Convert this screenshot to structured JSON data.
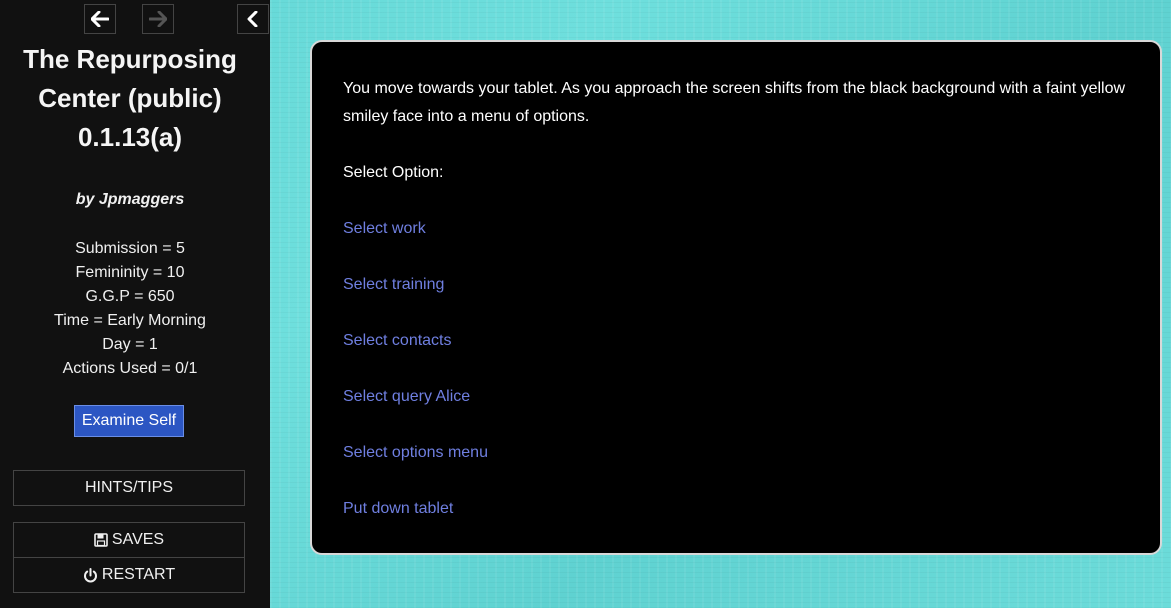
{
  "nav": {
    "back_icon": "arrow-left-icon",
    "forward_icon": "arrow-right-icon",
    "collapse_icon": "chevron-left-icon"
  },
  "sidebar": {
    "title_line1": "The Repurposing",
    "title_line2": "Center (public)",
    "title_line3": "0.1.13(a)",
    "author": "by Jpmaggers",
    "stats": [
      "Submission = 5",
      "Femininity = 10",
      "G.G.P = 650",
      "Time = Early Morning",
      "Day = 1",
      "Actions Used = 0/1"
    ],
    "examine_button": "Examine Self",
    "hints_label": "HINTS/TIPS",
    "saves_label": "SAVES",
    "restart_label": "RESTART",
    "saves_icon": "floppy-disk-icon",
    "restart_icon": "power-icon"
  },
  "passage": {
    "intro": "You move towards your tablet. As you approach the screen shifts from the black background with a faint yellow smiley face into a menu of options.",
    "prompt": "Select Option:",
    "links": [
      "Select work",
      "Select training",
      "Select contacts",
      "Select query Alice",
      "Select options menu",
      "Put down tablet"
    ]
  },
  "colors": {
    "background": "#62d6d5",
    "sidebar": "#111111",
    "passage": "#000000",
    "link": "#6f7fe0",
    "button": "#2c56c3"
  }
}
